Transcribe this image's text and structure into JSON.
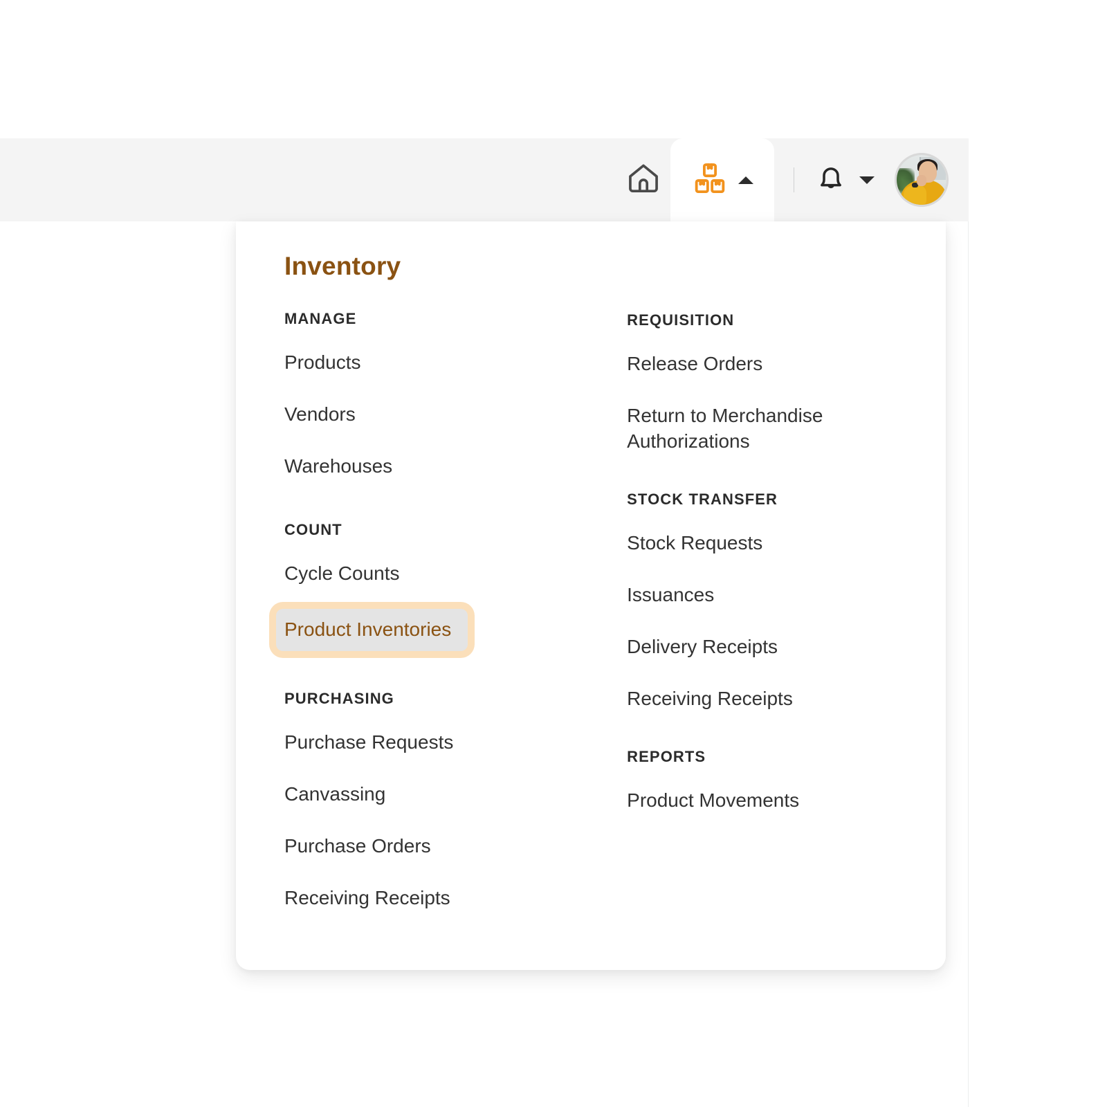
{
  "topbar": {
    "home_icon": "home-icon",
    "active_module_icon": "boxes-icon",
    "active_module_caret": "caret-up-icon",
    "notifications_icon": "bell-icon",
    "notifications_caret": "caret-down-icon",
    "avatar_label": "user-avatar",
    "accent_color": "#F2921D"
  },
  "menu": {
    "title": "Inventory",
    "title_color": "#8A5212",
    "selected_item": "Product Inventories",
    "selected_bg": "#E4E4E4",
    "selected_ring": "#FBDFBA",
    "columns": [
      {
        "groups": [
          {
            "label": "MANAGE",
            "items": [
              "Products",
              "Vendors",
              "Warehouses"
            ]
          },
          {
            "label": "COUNT",
            "items": [
              "Cycle Counts",
              "Product Inventories"
            ]
          },
          {
            "label": "PURCHASING",
            "items": [
              "Purchase Requests",
              "Canvassing",
              "Purchase Orders",
              "Receiving Receipts"
            ]
          }
        ]
      },
      {
        "groups": [
          {
            "label": "REQUISITION",
            "items": [
              "Release Orders",
              "Return to Merchandise Authorizations"
            ]
          },
          {
            "label": "STOCK TRANSFER",
            "items": [
              "Stock Requests",
              "Issuances",
              "Delivery Receipts",
              "Receiving Receipts"
            ]
          },
          {
            "label": "REPORTS",
            "items": [
              "Product Movements"
            ]
          }
        ]
      }
    ]
  }
}
